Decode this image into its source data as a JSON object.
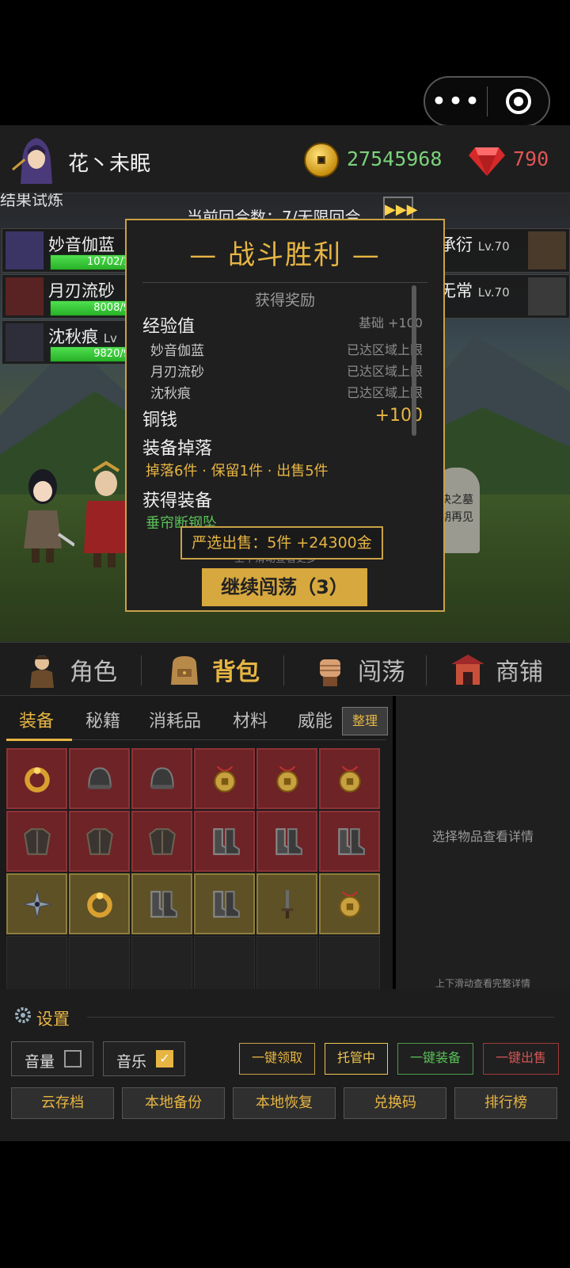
{
  "capsule": {
    "more_glyph": "•••"
  },
  "header": {
    "player_name": "花丶未眠",
    "coins": "27545968",
    "gems": "790"
  },
  "battle": {
    "title_fragment": "结果试炼",
    "round_text": "当前回合数：7/无限回合",
    "fast_forward": "▶▶▶",
    "allies": [
      {
        "name": "妙音伽蓝",
        "hp": "10702/1",
        "hp_pct": 100
      },
      {
        "name": "月刃流砂",
        "hp": "8008/9",
        "hp_pct": 100
      },
      {
        "name": "沈秋痕",
        "level": "Lv",
        "hp": "9820/9",
        "hp_pct": 100
      }
    ],
    "enemies": [
      {
        "name": "承衍",
        "level": "Lv.70"
      },
      {
        "name": "无常",
        "level": "Lv.70"
      }
    ],
    "tomb_text": [
      "决之墓",
      "胡再见"
    ]
  },
  "modal": {
    "title": "— 战斗胜利 —",
    "rewards_header": "获得奖励",
    "exp_label": "经验值",
    "exp_base": "基础 +100",
    "exp_members": [
      {
        "name": "妙音伽蓝",
        "status": "已达区域上限"
      },
      {
        "name": "月刃流砂",
        "status": "已达区域上限"
      },
      {
        "name": "沈秋痕",
        "status": "已达区域上限"
      }
    ],
    "copper_label": "铜钱",
    "copper_value": "+100",
    "drop_label": "装备掉落",
    "drop_summary": "掉落6件 · 保留1件 · 出售5件",
    "obtained_label": "获得装备",
    "obtained_item": "垂帘断钢坠",
    "auto_sell": "严选出售：5件 +24300金",
    "scroll_hint": "上下滑动查看更多",
    "continue_button": "继续闯荡（3）"
  },
  "tabs": [
    {
      "label": "角色",
      "active": false
    },
    {
      "label": "背包",
      "active": true
    },
    {
      "label": "闯荡",
      "active": false
    },
    {
      "label": "商铺",
      "active": false
    }
  ],
  "inventory": {
    "subtabs": [
      "装备",
      "秘籍",
      "消耗品",
      "材料",
      "威能"
    ],
    "sort_button": "整理",
    "rows": [
      [
        "ring-icon",
        "helmet-icon",
        "helmet-icon",
        "amulet-icon",
        "amulet-icon",
        "amulet-icon"
      ],
      [
        "armor-icon",
        "armor-icon",
        "armor-icon",
        "boots-icon",
        "boots-icon",
        "boots-icon"
      ],
      [
        "shuriken-icon",
        "ring-icon",
        "boots-icon",
        "boots-icon",
        "dagger-icon",
        "amulet-icon"
      ]
    ],
    "row_styles": [
      "red",
      "red",
      "yel",
      "emp"
    ]
  },
  "detail": {
    "placeholder": "选择物品查看详情",
    "hint": "上下滑动查看完整详情"
  },
  "settings": {
    "title": "设置",
    "volume_label": "音量",
    "music_label": "音乐",
    "music_check": "✓",
    "actions": [
      {
        "label": "一键领取",
        "color": "#c9a247",
        "text": "#e7b543"
      },
      {
        "label": "托管中",
        "color": "#f0c850",
        "text": "#f0c850"
      },
      {
        "label": "一键装备",
        "color": "#4d9a4d",
        "text": "#58c058"
      },
      {
        "label": "一键出售",
        "color": "#a03a3a",
        "text": "#d55555"
      }
    ],
    "bottom_buttons": [
      "云存档",
      "本地备份",
      "本地恢复",
      "兑换码",
      "排行榜"
    ]
  }
}
